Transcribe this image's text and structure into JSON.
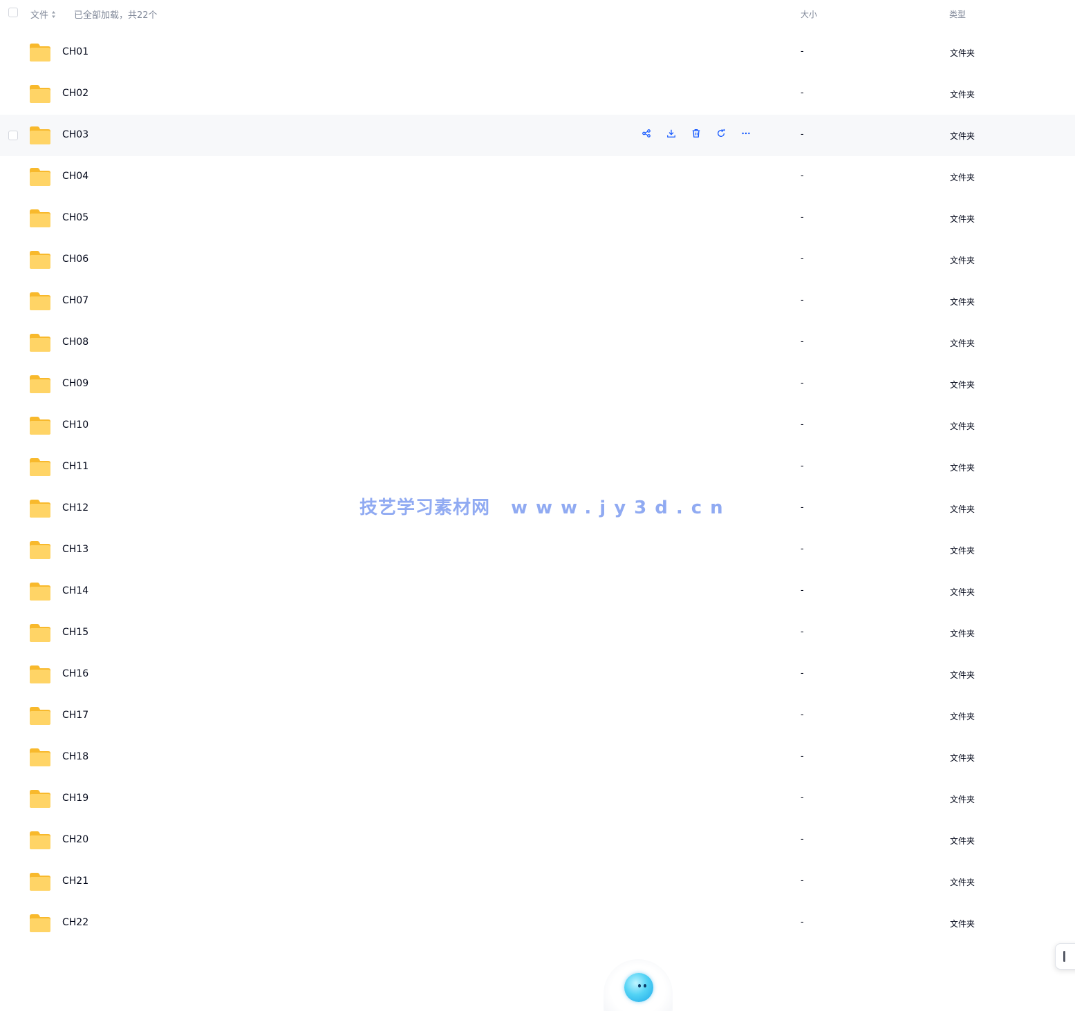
{
  "header": {
    "name_label": "文件",
    "loaded_text": "已全部加载，共22个",
    "size_label": "大小",
    "type_label": "类型"
  },
  "rows": [
    {
      "name": "CH01",
      "size": "-",
      "type": "文件夹"
    },
    {
      "name": "CH02",
      "size": "-",
      "type": "文件夹"
    },
    {
      "name": "CH03",
      "size": "-",
      "type": "文件夹"
    },
    {
      "name": "CH04",
      "size": "-",
      "type": "文件夹"
    },
    {
      "name": "CH05",
      "size": "-",
      "type": "文件夹"
    },
    {
      "name": "CH06",
      "size": "-",
      "type": "文件夹"
    },
    {
      "name": "CH07",
      "size": "-",
      "type": "文件夹"
    },
    {
      "name": "CH08",
      "size": "-",
      "type": "文件夹"
    },
    {
      "name": "CH09",
      "size": "-",
      "type": "文件夹"
    },
    {
      "name": "CH10",
      "size": "-",
      "type": "文件夹"
    },
    {
      "name": "CH11",
      "size": "-",
      "type": "文件夹"
    },
    {
      "name": "CH12",
      "size": "-",
      "type": "文件夹"
    },
    {
      "name": "CH13",
      "size": "-",
      "type": "文件夹"
    },
    {
      "name": "CH14",
      "size": "-",
      "type": "文件夹"
    },
    {
      "name": "CH15",
      "size": "-",
      "type": "文件夹"
    },
    {
      "name": "CH16",
      "size": "-",
      "type": "文件夹"
    },
    {
      "name": "CH17",
      "size": "-",
      "type": "文件夹"
    },
    {
      "name": "CH18",
      "size": "-",
      "type": "文件夹"
    },
    {
      "name": "CH19",
      "size": "-",
      "type": "文件夹"
    },
    {
      "name": "CH20",
      "size": "-",
      "type": "文件夹"
    },
    {
      "name": "CH21",
      "size": "-",
      "type": "文件夹"
    },
    {
      "name": "CH22",
      "size": "-",
      "type": "文件夹"
    }
  ],
  "hovered_row": "CH03",
  "row_actions": [
    "share-icon",
    "download-icon",
    "delete-icon",
    "refresh-icon",
    "more-icon"
  ],
  "watermark": {
    "site_name": "技艺学习素材网",
    "url": "www.jy3d.cn"
  },
  "colors": {
    "accent": "#0d53ff",
    "folder": "#fdc84a",
    "muted_text": "#818999",
    "hover_row": "#f7f8fa",
    "watermark": "#7d9cf0"
  }
}
